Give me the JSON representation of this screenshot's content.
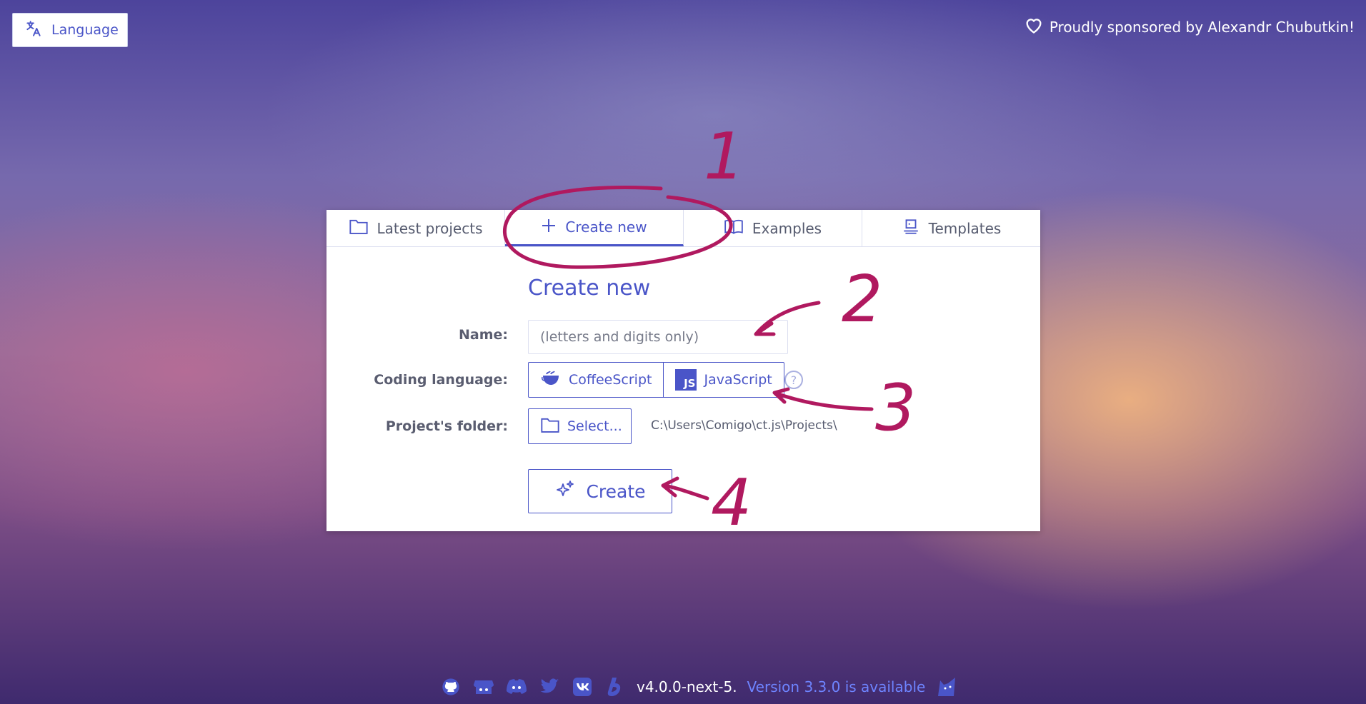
{
  "header": {
    "language_label": "Language",
    "sponsor_text": "Proudly sponsored by Alexandr Chubutkin!"
  },
  "tabs": [
    {
      "label": "Latest projects",
      "icon": "folder-icon"
    },
    {
      "label": "Create new",
      "icon": "plus-icon",
      "active": true
    },
    {
      "label": "Examples",
      "icon": "book-icon"
    },
    {
      "label": "Templates",
      "icon": "templates-icon"
    }
  ],
  "form": {
    "title": "Create new",
    "name_label": "Name:",
    "name_value": "",
    "name_placeholder": "(letters and digits only)",
    "coding_language_label": "Coding language:",
    "languages": [
      "CoffeeScript",
      "JavaScript"
    ],
    "js_badge": "JS",
    "help_symbol": "?",
    "folder_label": "Project's folder:",
    "select_label": "Select...",
    "folder_path": "C:\\Users\\Comigo\\ct.js\\Projects\\",
    "create_label": "Create"
  },
  "annotations": [
    "1",
    "2",
    "3",
    "4"
  ],
  "footer": {
    "version": "v4.0.0-next-5.",
    "update_text": "Version 3.3.0 is available",
    "links": [
      "github-icon",
      "itch-icon",
      "discord-icon",
      "twitter-icon",
      "vk-icon",
      "boosty-icon",
      "ctjs-cat-icon"
    ]
  },
  "colors": {
    "accent": "#4a55c8",
    "annotation": "#b0195f"
  }
}
